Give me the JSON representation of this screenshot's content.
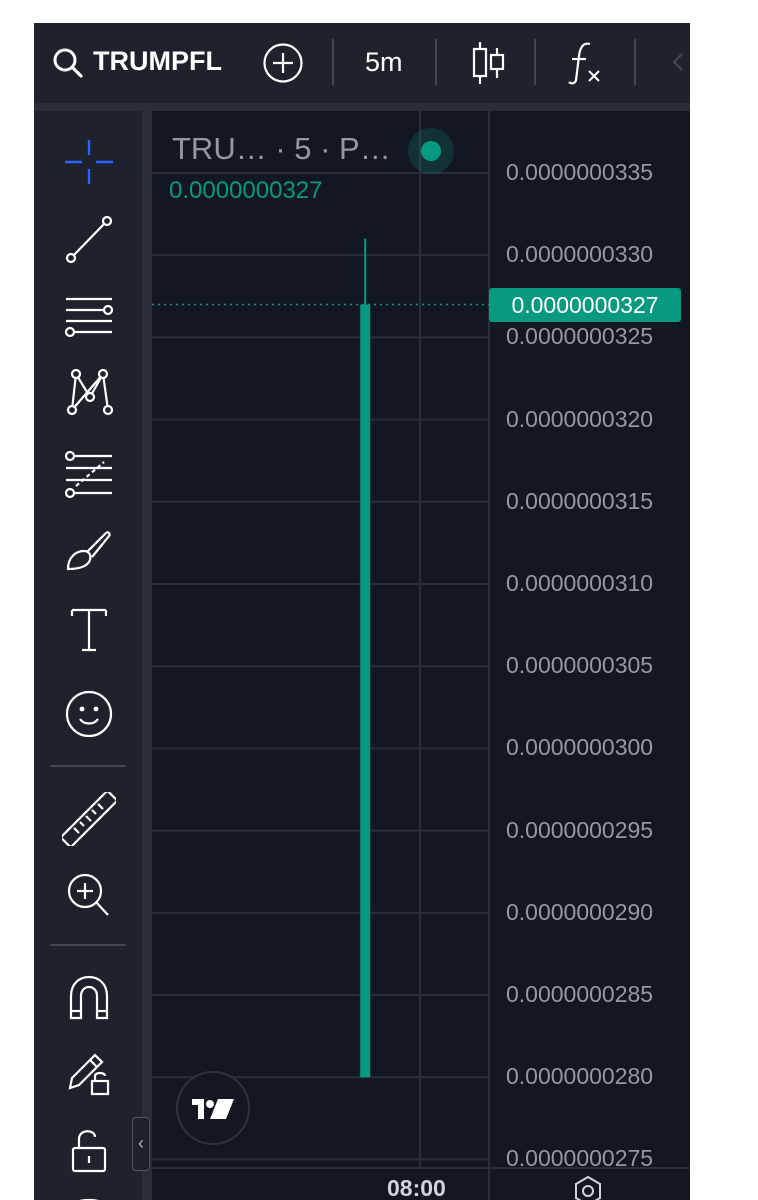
{
  "toolbar": {
    "symbol": "TRUMPFL",
    "interval": "5m",
    "icons": [
      "search-icon",
      "add-symbol-icon",
      "candles-icon",
      "indicators-icon"
    ]
  },
  "sidebar": {
    "tools": [
      "crosshair-icon",
      "trend-line-icon",
      "parallel-lines-icon",
      "pattern-icon",
      "fib-icon",
      "brush-icon",
      "text-icon",
      "emoji-icon",
      "ruler-icon",
      "zoom-in-icon",
      "magnet-icon",
      "lock-drawings-icon",
      "lock-icon",
      "eye-icon"
    ],
    "collapse": "‹"
  },
  "legend": {
    "symbol": "TRU…  · 5 · P…",
    "price": "0.0000000327"
  },
  "chart_data": {
    "type": "candlestick",
    "interval": "5m",
    "y_ticks": [
      "0.0000000335",
      "0.0000000330",
      "0.0000000325",
      "0.0000000320",
      "0.0000000315",
      "0.0000000310",
      "0.0000000305",
      "0.0000000300",
      "0.0000000295",
      "0.0000000290",
      "0.0000000285",
      "0.0000000280",
      "0.0000000275"
    ],
    "ylim": [
      2.74e-08,
      3.36e-08
    ],
    "x_ticks": [
      "08:00"
    ],
    "candles": [
      {
        "open": 2.8e-08,
        "high": 3.31e-08,
        "low": 2.8e-08,
        "close": 3.27e-08,
        "time_offset_min": -10
      }
    ],
    "last_price": "0.0000000327",
    "colors": {
      "up": "#089981",
      "grid": "#2a2e39",
      "text": "#9598a1"
    }
  }
}
